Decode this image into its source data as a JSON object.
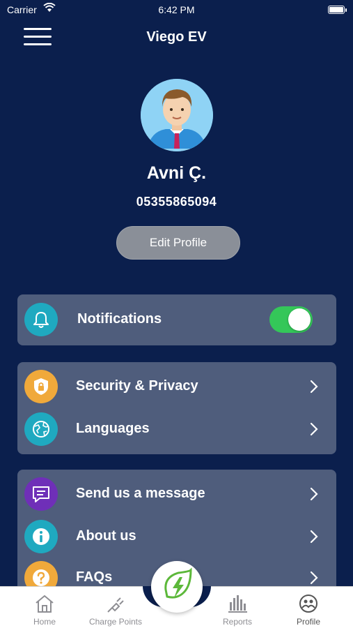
{
  "status_bar": {
    "carrier": "Carrier",
    "time": "6:42 PM"
  },
  "nav": {
    "title": "Viego EV"
  },
  "profile": {
    "name": "Avni Ç.",
    "phone": "05355865094",
    "edit_label": "Edit Profile"
  },
  "notifications": {
    "label": "Notifications",
    "enabled": true,
    "icon": "bell-icon",
    "icon_color": "#1fa9c0"
  },
  "settings": [
    {
      "label": "Security & Privacy",
      "icon": "shield-lock-icon",
      "icon_color": "#f0a93b"
    },
    {
      "label": "Languages",
      "icon": "globe-icon",
      "icon_color": "#1fa9c0"
    }
  ],
  "info": [
    {
      "label": "Send us a message",
      "icon": "message-icon",
      "icon_color": "#6f2fb8"
    },
    {
      "label": "About us",
      "icon": "info-icon",
      "icon_color": "#1fa9c0"
    },
    {
      "label": "FAQs",
      "icon": "question-icon",
      "icon_color": "#f0a93b"
    }
  ],
  "tabs": [
    {
      "label": "Home",
      "icon": "home-icon"
    },
    {
      "label": "Charge Points",
      "icon": "plug-icon"
    },
    {
      "label": "Reports",
      "icon": "bar-chart-icon"
    },
    {
      "label": "Profile",
      "icon": "profile-group-icon"
    }
  ],
  "colors": {
    "background": "#0b1f4d",
    "card": "#4f5d7c",
    "toggle_on": "#34c759",
    "fab_green": "#5cb83a"
  }
}
